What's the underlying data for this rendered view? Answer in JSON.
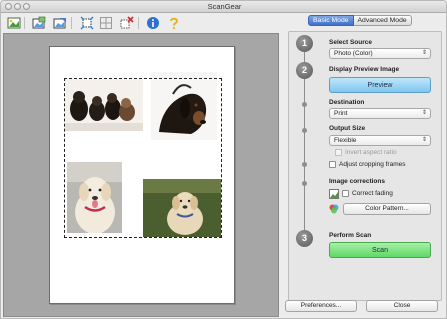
{
  "window": {
    "title": "ScanGear"
  },
  "toolbar": {
    "items": [
      {
        "icon": "scan-image-icon"
      },
      {
        "icon": "auto-crop-icon"
      },
      {
        "icon": "clear-crop-icon"
      },
      {
        "icon": "rotate-crop-icon"
      },
      {
        "icon": "grid-icon"
      },
      {
        "icon": "delete-crop-icon"
      },
      {
        "icon": "info-icon"
      },
      {
        "icon": "help-icon"
      }
    ]
  },
  "tabs": {
    "basic": "Basic Mode",
    "advanced": "Advanced Mode"
  },
  "steps": {
    "one": "1",
    "two": "2",
    "three": "3"
  },
  "source": {
    "label": "Select Source",
    "value": "Photo (Color)"
  },
  "display": {
    "label": "Display Preview Image",
    "button": "Preview"
  },
  "destination": {
    "label": "Destination",
    "value": "Print"
  },
  "output": {
    "label": "Output Size",
    "value": "Flexible",
    "invert_label": "Invert aspect ratio",
    "adjust_label": "Adjust cropping frames"
  },
  "corrections": {
    "label": "Image corrections",
    "fading_label": "Correct fading",
    "color_button": "Color Pattern..."
  },
  "perform": {
    "label": "Perform Scan",
    "button": "Scan"
  },
  "footer": {
    "preferences": "Preferences...",
    "close": "Close"
  },
  "colors": {
    "preview_blue": "#7fc6ee",
    "scan_green": "#5fd866",
    "tab_active": "#3f72c8"
  }
}
